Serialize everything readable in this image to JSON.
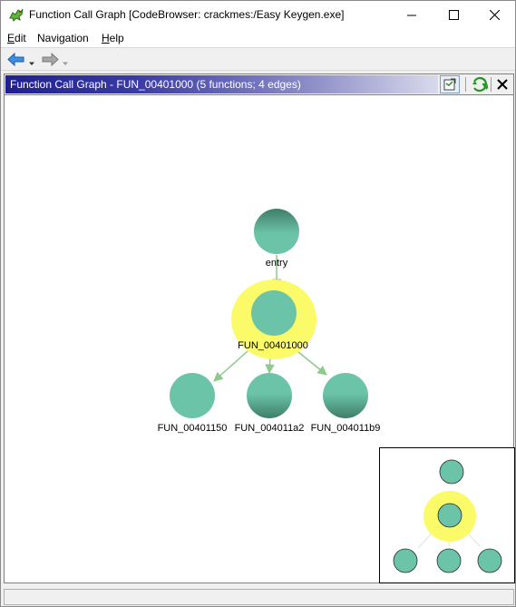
{
  "window": {
    "title": "Function Call Graph [CodeBrowser: crackmes:/Easy Keygen.exe]"
  },
  "menu": {
    "items": [
      {
        "label": "Edit",
        "mnemonic": "E",
        "rest": "dit"
      },
      {
        "label": "Navigation",
        "mnemonic": "",
        "rest": "Navigation"
      },
      {
        "label": "Help",
        "mnemonic": "H",
        "rest": "elp"
      }
    ]
  },
  "toolbar": {
    "back": {
      "icon": "back-arrow-icon"
    },
    "forward": {
      "icon": "forward-arrow-icon"
    }
  },
  "panel": {
    "title": "Function Call Graph - FUN_00401000 (5 functions; 4 edges)",
    "buttons": [
      {
        "icon": "export-graph-icon"
      },
      {
        "icon": "refresh-icon"
      },
      {
        "icon": "close-icon"
      }
    ]
  },
  "graph": {
    "nodes": [
      {
        "id": "entry",
        "label": "entry",
        "selected": false
      },
      {
        "id": "fun_00401000",
        "label": "FUN_00401000",
        "selected": true
      },
      {
        "id": "fun_00401150",
        "label": "FUN_00401150",
        "selected": false
      },
      {
        "id": "fun_004011a2",
        "label": "FUN_004011a2",
        "selected": false
      },
      {
        "id": "fun_004011b9",
        "label": "FUN_004011b9",
        "selected": false
      }
    ],
    "edges": [
      {
        "from": "entry",
        "to": "fun_00401000"
      },
      {
        "from": "fun_00401000",
        "to": "fun_00401150"
      },
      {
        "from": "fun_00401000",
        "to": "fun_004011a2"
      },
      {
        "from": "fun_00401000",
        "to": "fun_004011b9"
      }
    ],
    "colors": {
      "node_fill": "#6cc4a8",
      "node_dark": "#3e7a66",
      "selection_halo": "#fbfb6a",
      "edge": "#8ec98e"
    }
  },
  "satellite": {
    "node_fill": "#6cc4a8",
    "halo": "#fbfb6a"
  }
}
